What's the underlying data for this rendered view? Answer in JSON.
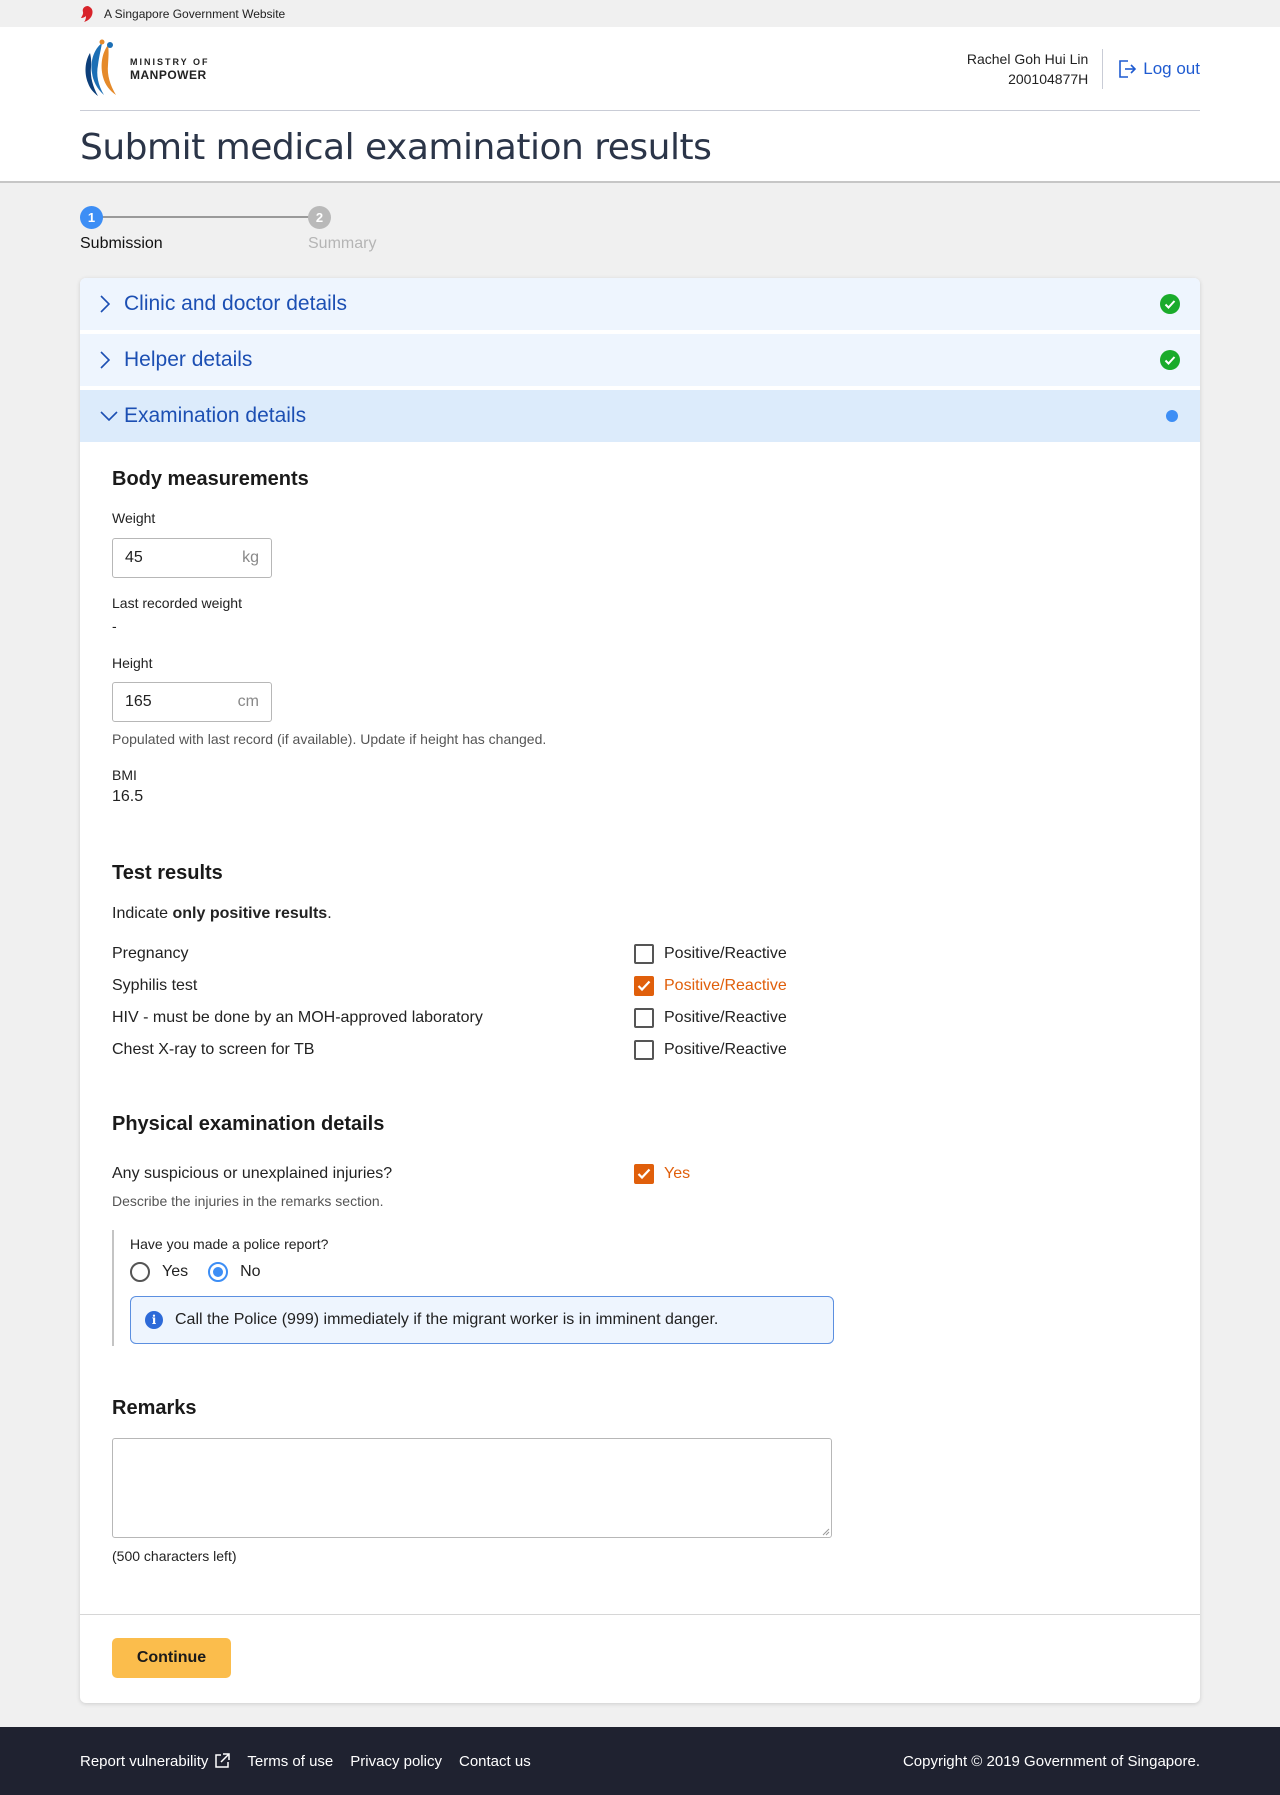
{
  "gov_banner": {
    "text": "A Singapore Government Website"
  },
  "header": {
    "logo": {
      "line1": "MINISTRY OF",
      "line2": "MANPOWER"
    },
    "user": {
      "name": "Rachel Goh Hui Lin",
      "id": "200104877H"
    },
    "logout_label": "Log out",
    "page_title": "Submit medical examination results"
  },
  "stepper": {
    "steps": [
      {
        "number": "1",
        "label": "Submission",
        "state": "active"
      },
      {
        "number": "2",
        "label": "Summary",
        "state": "inactive"
      }
    ]
  },
  "accordion": [
    {
      "title": "Clinic and doctor details",
      "status": "complete"
    },
    {
      "title": "Helper details",
      "status": "complete"
    },
    {
      "title": "Examination details",
      "status": "in-progress"
    }
  ],
  "body_measurements": {
    "heading": "Body measurements",
    "weight": {
      "label": "Weight",
      "value": "45",
      "unit": "kg"
    },
    "last_weight": {
      "label": "Last recorded weight",
      "value": "-"
    },
    "height": {
      "label": "Height",
      "value": "165",
      "unit": "cm",
      "hint": "Populated with last record (if available). Update if height has changed."
    },
    "bmi": {
      "label": "BMI",
      "value": "16.5"
    }
  },
  "test_results": {
    "heading": "Test results",
    "intro_prefix": "Indicate ",
    "intro_bold": "only positive results",
    "intro_suffix": ".",
    "checkbox_label": "Positive/Reactive",
    "tests": [
      {
        "name": "Pregnancy",
        "checked": false
      },
      {
        "name": "Syphilis test",
        "checked": true
      },
      {
        "name": "HIV - must be done by an MOH-approved laboratory",
        "checked": false
      },
      {
        "name": "Chest X-ray to screen for TB",
        "checked": false
      }
    ]
  },
  "physical_exam": {
    "heading": "Physical examination details",
    "injuries_question": "Any suspicious or unexplained injuries?",
    "injuries_label": "Yes",
    "injuries_checked": true,
    "injuries_hint": "Describe the injuries in the remarks section.",
    "police_question": "Have you made a police report?",
    "police_options": [
      "Yes",
      "No"
    ],
    "police_selected": "No",
    "info_text": "Call the Police (999) immediately if the migrant worker is in imminent danger."
  },
  "remarks": {
    "heading": "Remarks",
    "value": "",
    "chars_left": "(500 characters left)"
  },
  "actions": {
    "continue_label": "Continue"
  },
  "footer": {
    "links": [
      "Report vulnerability",
      "Terms of use",
      "Privacy policy",
      "Contact us"
    ],
    "copyright": "Copyright © 2019 Government of Singapore."
  },
  "colors": {
    "accent_blue": "#3d8ef5",
    "link_blue": "#1c4fb3",
    "success_green": "#1aab2b",
    "checked_orange": "#e05f0b",
    "button_yellow": "#fbbd4c",
    "footer_bg": "#1f2230"
  }
}
